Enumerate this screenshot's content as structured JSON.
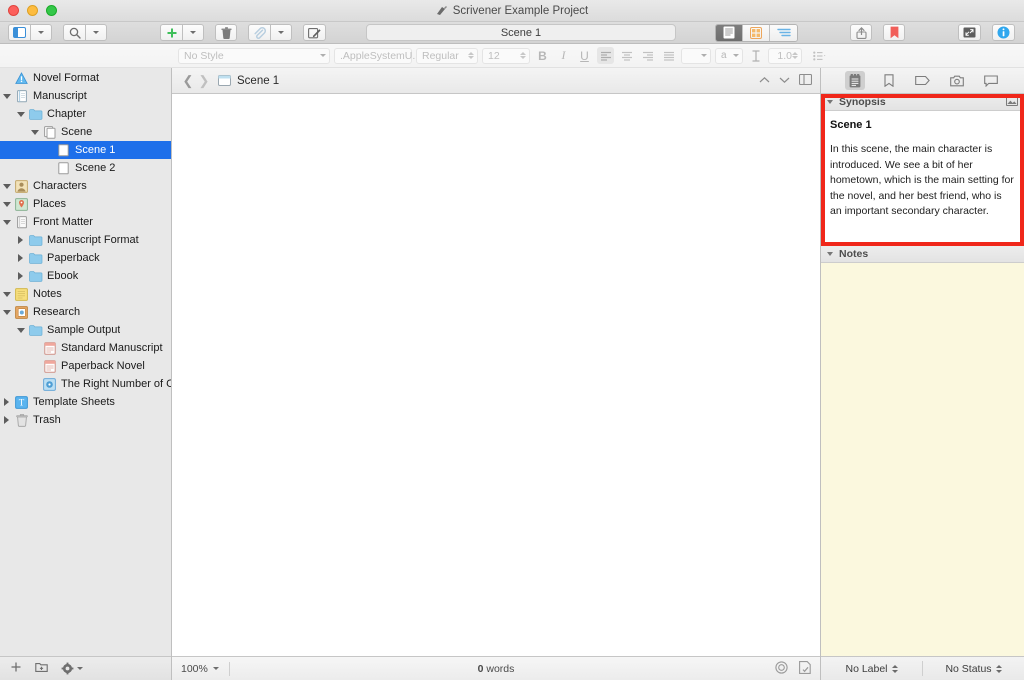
{
  "window": {
    "title": "Scrivener Example Project",
    "app_icon": "scrivener-icon",
    "traffic_lights": [
      "close",
      "minimize",
      "zoom"
    ]
  },
  "toolbar": {
    "view_binder_label": "view-binder",
    "search_label": "search",
    "add_label": "add",
    "trash_label": "move-to-trash",
    "attach_label": "attach-reference",
    "compose_label": "compose",
    "document_title_field": "Scene 1",
    "view_modes": [
      {
        "name": "scrivenings",
        "active": true
      },
      {
        "name": "corkboard",
        "active": false
      },
      {
        "name": "outliner",
        "active": false
      }
    ],
    "share_label": "share",
    "bookmark_label": "bookmarks",
    "compose_mode_label": "composition-mode",
    "inspector_label": "toggle-inspector"
  },
  "format_bar": {
    "style": "No Style",
    "font": ".AppleSystemU...",
    "weight": "Regular",
    "size": "12",
    "bold": "B",
    "italic": "I",
    "underline": "U",
    "line_spacing": "1.0"
  },
  "binder": {
    "items": [
      {
        "label": "Novel Format",
        "indent": 0,
        "disclosure": "none",
        "icon": "warning-triangle-icon",
        "selected": false
      },
      {
        "label": "Manuscript",
        "indent": 0,
        "disclosure": "open",
        "icon": "manuscript-icon",
        "selected": false
      },
      {
        "label": "Chapter",
        "indent": 1,
        "disclosure": "open",
        "icon": "folder-icon",
        "selected": false
      },
      {
        "label": "Scene",
        "indent": 2,
        "disclosure": "open",
        "icon": "stacked-docs-icon",
        "selected": false
      },
      {
        "label": "Scene 1",
        "indent": 3,
        "disclosure": "none",
        "icon": "document-icon",
        "selected": true
      },
      {
        "label": "Scene 2",
        "indent": 3,
        "disclosure": "none",
        "icon": "document-icon",
        "selected": false
      },
      {
        "label": "Characters",
        "indent": 0,
        "disclosure": "open",
        "icon": "characters-icon",
        "selected": false
      },
      {
        "label": "Places",
        "indent": 0,
        "disclosure": "open",
        "icon": "places-icon",
        "selected": false
      },
      {
        "label": "Front Matter",
        "indent": 0,
        "disclosure": "open",
        "icon": "front-matter-icon",
        "selected": false
      },
      {
        "label": "Manuscript Format",
        "indent": 1,
        "disclosure": "closed",
        "icon": "folder-icon",
        "selected": false
      },
      {
        "label": "Paperback",
        "indent": 1,
        "disclosure": "closed",
        "icon": "folder-icon",
        "selected": false
      },
      {
        "label": "Ebook",
        "indent": 1,
        "disclosure": "closed",
        "icon": "folder-icon",
        "selected": false
      },
      {
        "label": "Notes",
        "indent": 0,
        "disclosure": "open",
        "icon": "notes-icon",
        "selected": false
      },
      {
        "label": "Research",
        "indent": 0,
        "disclosure": "open",
        "icon": "research-icon",
        "selected": false
      },
      {
        "label": "Sample Output",
        "indent": 1,
        "disclosure": "open",
        "icon": "folder-icon",
        "selected": false
      },
      {
        "label": "Standard Manuscript",
        "indent": 2,
        "disclosure": "none",
        "icon": "pdf-icon",
        "selected": false
      },
      {
        "label": "Paperback Novel",
        "indent": 2,
        "disclosure": "none",
        "icon": "pdf-icon",
        "selected": false
      },
      {
        "label": "The Right Number of Cups -",
        "indent": 2,
        "disclosure": "none",
        "icon": "media-icon",
        "selected": false
      },
      {
        "label": "Template Sheets",
        "indent": 0,
        "disclosure": "closed",
        "icon": "template-icon",
        "selected": false
      },
      {
        "label": "Trash",
        "indent": 0,
        "disclosure": "closed",
        "icon": "trash-icon",
        "selected": false
      }
    ],
    "footer": {
      "add_label": "add-item",
      "add_folder_label": "add-folder",
      "settings_label": "binder-settings"
    }
  },
  "editor": {
    "back_label": "back",
    "forward_label": "forward",
    "doc_icon": "text-document-icon",
    "doc_title": "Scene 1",
    "header_up_label": "previous-document",
    "header_down_label": "next-document",
    "split_label": "split-editor",
    "body_text": "",
    "footer": {
      "zoom": "100%",
      "word_count_number": "0",
      "word_count_unit": "words",
      "target_label": "writing-target",
      "settings_label": "editor-options"
    }
  },
  "inspector": {
    "tabs": [
      {
        "name": "notes-tab",
        "active": true
      },
      {
        "name": "bookmarks-tab",
        "active": false
      },
      {
        "name": "metadata-tab",
        "active": false
      },
      {
        "name": "snapshots-tab",
        "active": false
      },
      {
        "name": "comments-tab",
        "active": false
      }
    ],
    "synopsis": {
      "header": "Synopsis",
      "image_toggle_label": "synopsis-image-toggle",
      "title": "Scene 1",
      "text": "In this scene, the main character is introduced. We see a bit of her hometown, which is the main setting for the novel, and her best friend, who is an important secondary character.",
      "highlight_color": "#f0271a"
    },
    "notes": {
      "header": "Notes",
      "content": ""
    },
    "footer": {
      "label_value": "No Label",
      "status_value": "No Status"
    }
  },
  "colors": {
    "selection_blue": "#1e6fea",
    "highlight_red": "#f0271a",
    "notes_paper": "#fbf8de",
    "chrome_gray": "#e8e8e8"
  }
}
